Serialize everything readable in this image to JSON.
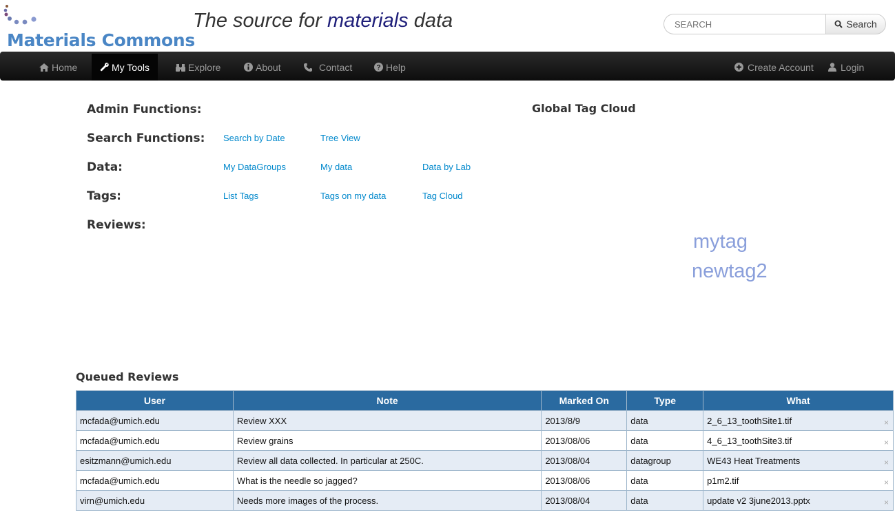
{
  "header": {
    "logo_text": "Materials Commons",
    "tagline_pre": "The source for ",
    "tagline_highlight": "materials",
    "tagline_post": " data",
    "search_placeholder": "SEARCH",
    "search_button": "Search"
  },
  "nav": {
    "home": "Home",
    "my_tools": "My Tools",
    "explore": "Explore",
    "about": "About",
    "contact": "Contact",
    "help": "Help",
    "create_account": "Create Account",
    "login": "Login"
  },
  "tools": {
    "admin_label": "Admin Functions:",
    "search_label": "Search Functions:",
    "search_by_date": "Search by Date",
    "tree_view": "Tree View",
    "data_label": "Data:",
    "my_datagroups": "My DataGroups",
    "my_data": "My data",
    "data_by_lab": "Data by Lab",
    "tags_label": "Tags:",
    "list_tags": "List Tags",
    "tags_on_my_data": "Tags on my data",
    "tag_cloud": "Tag Cloud",
    "reviews_label": "Reviews:"
  },
  "tag_cloud": {
    "title": "Global Tag Cloud",
    "tags": [
      "mytag",
      "newtag2"
    ]
  },
  "queued_reviews": {
    "title": "Queued Reviews",
    "columns": [
      "User",
      "Note",
      "Marked On",
      "Type",
      "What"
    ],
    "rows": [
      [
        "mcfada@umich.edu",
        "Review XXX",
        "2013/8/9",
        "data",
        "2_6_13_toothSite1.tif"
      ],
      [
        "mcfada@umich.edu",
        "Review grains",
        "2013/08/06",
        "data",
        "4_6_13_toothSite3.tif"
      ],
      [
        "esitzmann@umich.edu",
        "Review all data collected. In particular at 250C.",
        "2013/08/04",
        "datagroup",
        "WE43 Heat Treatments"
      ],
      [
        "mcfada@umich.edu",
        "What is the needle so jagged?",
        "2013/08/06",
        "data",
        "p1m2.tif"
      ],
      [
        "virn@umich.edu",
        "Needs more images of the process.",
        "2013/08/04",
        "data",
        "update v2 3june2013.pptx"
      ]
    ],
    "remove_glyph": "×"
  }
}
